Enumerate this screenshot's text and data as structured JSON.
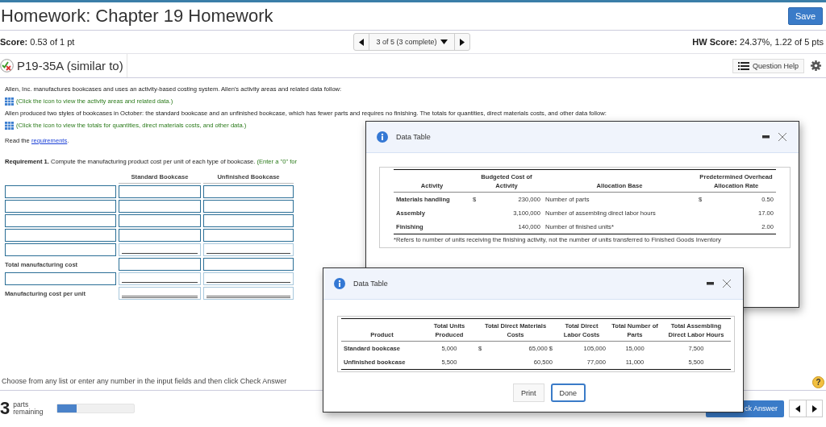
{
  "header": {
    "title": "Homework: Chapter 19 Homework",
    "save": "Save"
  },
  "score_bar": {
    "score_label": "Score:",
    "score": "0.53 of 1 pt",
    "nav": "3 of 5 (3 complete)",
    "hw_label": "HW Score:",
    "hw_score": "24.37%, 1.22 of 5 pts"
  },
  "question": {
    "title": "P19-35A (similar to)",
    "help": "Question Help"
  },
  "body": [
    {
      "kind": "text",
      "text": "Allen, Inc. manufactures bookcases and uses an activity-based costing system. Allen's activity areas and related data follow:"
    },
    {
      "kind": "link",
      "text": "(Click the icon to view the activity areas and related data.)"
    },
    {
      "kind": "text",
      "text": "Allen produced two styles of bookcases in October: the standard bookcase and an unfinished bookcase, which has fewer parts and requires no finishing. The totals for quantities, direct materials costs, and other data follow:"
    },
    {
      "kind": "link",
      "text": "(Click the icon to view the totals for quantities, direct materials costs, and other data.)"
    }
  ],
  "read": {
    "text": "Read the",
    "link": "requirements",
    "end": "."
  },
  "requirement": {
    "label": "Requirement 1.",
    "text": "Compute the manufacturing product cost per unit of each type of bookcase.",
    "hint": "(Enter a \"0\" for"
  },
  "answer_table": {
    "columns": [
      "Standard Bookcase",
      "Unfinished Bookcase"
    ],
    "rows": [
      {
        "kind": "entry",
        "sum_line": false,
        "double_line": false
      },
      {
        "kind": "entry",
        "sum_line": false,
        "double_line": false
      },
      {
        "kind": "entry",
        "sum_line": false,
        "double_line": false
      },
      {
        "kind": "entry",
        "sum_line": false,
        "double_line": false
      },
      {
        "kind": "entry",
        "sum_line": true,
        "double_line": false
      },
      {
        "kind": "label",
        "label": "Total manufacturing cost",
        "sum_line": false,
        "double_line": false
      },
      {
        "kind": "entry",
        "sum_line": true,
        "double_line": false
      },
      {
        "kind": "label",
        "label": "Manufacturing cost per unit",
        "sum_line": false,
        "double_line": true
      }
    ]
  },
  "instructions": "Choose from any list or enter any number in the input fields and then click Check Answer",
  "footer": {
    "count": "3",
    "parts_label": "parts remaining",
    "level": 0.25,
    "check": "ck Answer",
    "help": "?"
  },
  "dialogs": [
    {
      "title": "Data Table",
      "columns": [
        "Activity",
        "Budgeted Cost of Activity",
        "Allocation Base",
        "Predetermined Overhead Allocation Rate"
      ],
      "rows": [
        {
          "activity": "Materials handling",
          "dollar": "$",
          "cost": "230,000",
          "base": "Number of parts",
          "rate_dollar": "$",
          "rate": "0.50"
        },
        {
          "activity": "Assembly",
          "cost": "3,100,000",
          "base": "Number of assembling direct labor hours",
          "rate": "17.00"
        },
        {
          "activity": "Finishing",
          "cost": "140,000",
          "base": "Number of finished units*",
          "rate": "2.00"
        }
      ],
      "footnote": "*Refers to number of units receiving the finishing activity, not the number of units transferred to Finished Goods Inventory"
    },
    {
      "title": "Data Table",
      "columns": [
        "Product",
        "Total Units Produced",
        "Total Direct Materials Costs",
        "Total Direct Labor Costs",
        "Total Number of Parts",
        "Total Assembling Direct Labor Hours"
      ],
      "rows": [
        {
          "product": "Standard bookcase",
          "units": "5,000",
          "dollar": "$",
          "materials": "65,000 $",
          "labor": "105,000",
          "parts": "15,000",
          "hours": "7,500"
        },
        {
          "product": "Unfinished bookcase",
          "units": "5,500",
          "materials": "60,500",
          "labor": "77,000",
          "parts": "11,000",
          "hours": "5,500"
        }
      ],
      "buttons": [
        "Print",
        "Done"
      ]
    }
  ]
}
